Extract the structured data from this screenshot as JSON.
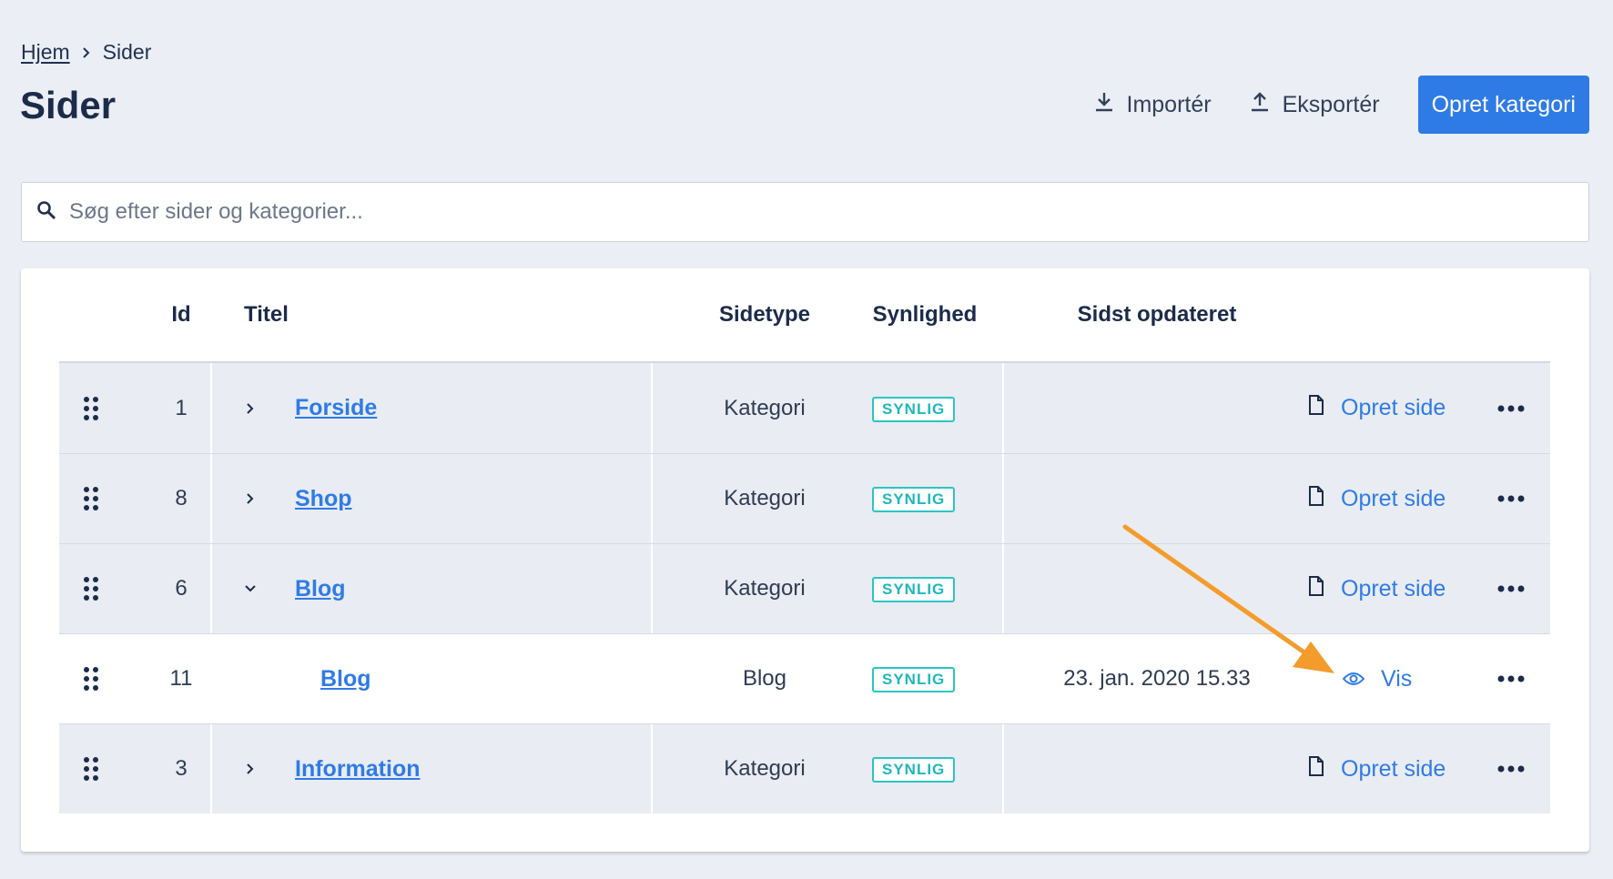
{
  "breadcrumb": {
    "home": "Hjem",
    "current": "Sider"
  },
  "page_title": "Sider",
  "header": {
    "import_label": "Importér",
    "export_label": "Eksportér",
    "create_category_label": "Opret kategori"
  },
  "search": {
    "placeholder": "Søg efter sider og kategorier..."
  },
  "colors": {
    "primary": "#2f7be6",
    "badge": "#2ec4c4",
    "arrow": "#f39c2b",
    "background": "#ebeef4"
  },
  "table": {
    "headers": {
      "id": "Id",
      "title": "Titel",
      "type": "Sidetype",
      "visibility": "Synlighed",
      "updated": "Sidst opdateret"
    },
    "rows": [
      {
        "id": "1",
        "chevron": "chevron-right-icon",
        "title": "Forside",
        "type": "Kategori",
        "visibility": "SYNLIG",
        "updated": "",
        "action": "Opret side",
        "action_icon": "document-icon"
      },
      {
        "id": "8",
        "chevron": "chevron-right-icon",
        "title": "Shop",
        "type": "Kategori",
        "visibility": "SYNLIG",
        "updated": "",
        "action": "Opret side",
        "action_icon": "document-icon"
      },
      {
        "id": "6",
        "chevron": "chevron-down-icon",
        "title": "Blog",
        "type": "Kategori",
        "visibility": "SYNLIG",
        "updated": "",
        "action": "Opret side",
        "action_icon": "document-icon"
      },
      {
        "id": "11",
        "chevron": "",
        "title": "Blog",
        "type": "Blog",
        "visibility": "SYNLIG",
        "updated": "23. jan. 2020 15.33",
        "action": "Vis",
        "action_icon": "eye-icon"
      },
      {
        "id": "3",
        "chevron": "chevron-right-icon",
        "title": "Information",
        "type": "Kategori",
        "visibility": "SYNLIG",
        "updated": "",
        "action": "Opret side",
        "action_icon": "document-icon"
      }
    ]
  }
}
